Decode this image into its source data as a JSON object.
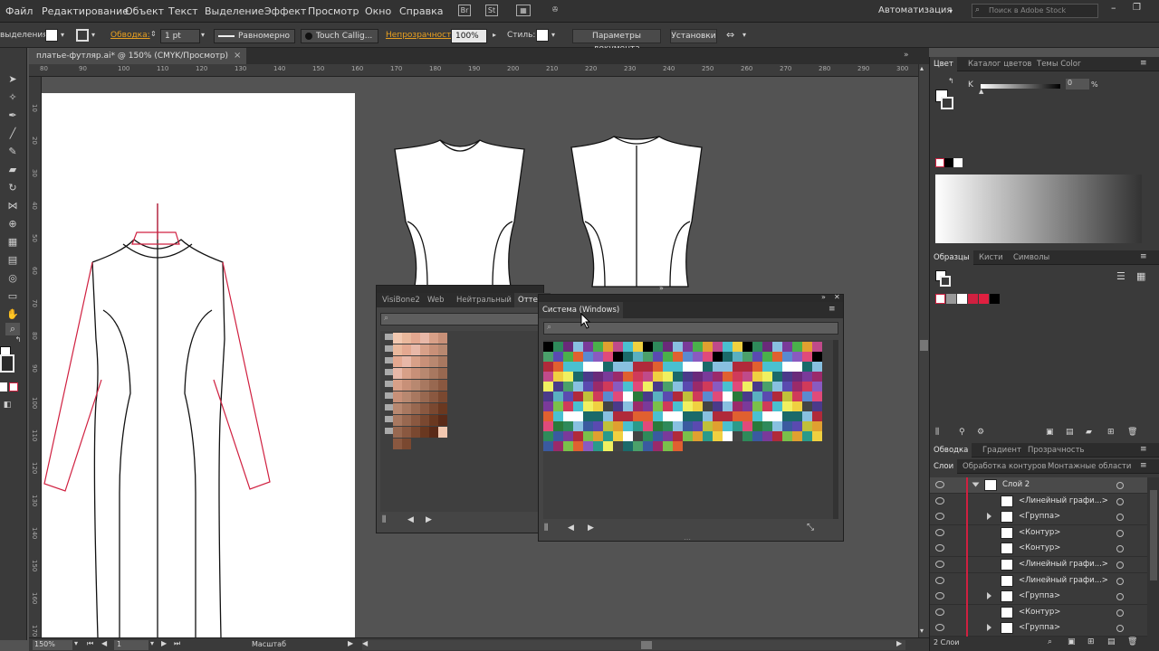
{
  "menubar": {
    "items": [
      "Файл",
      "Редактирование",
      "Объект",
      "Текст",
      "Выделение",
      "Эффект",
      "Просмотр",
      "Окно",
      "Справка"
    ],
    "bridge_icon": "Br",
    "stock_icon": "St",
    "workspace": "Автоматизация",
    "search_placeholder": "Поиск в Adobe Stock"
  },
  "control": {
    "selection_label": "выделения",
    "stroke_label": "Обводка:",
    "stroke_weight": "1 pt",
    "profile": "Равномерно",
    "brush": "Touch Callig...",
    "opacity_label": "Непрозрачность:",
    "opacity_value": "100%",
    "style_label": "Стиль:",
    "doc_settings": "Параметры документа",
    "preferences": "Установки"
  },
  "document": {
    "tab_title": "платье-футляр.ai* @ 150% (CMYK/Просмотр)",
    "close": "×"
  },
  "ruler": {
    "h_labels": [
      "80",
      "90",
      "100",
      "110",
      "120",
      "130",
      "140",
      "150",
      "160",
      "170",
      "180",
      "190",
      "200",
      "210",
      "220",
      "230",
      "240",
      "250",
      "260",
      "270",
      "280",
      "290",
      "300"
    ],
    "v_labels": [
      "10",
      "20",
      "30",
      "40",
      "50",
      "60",
      "70",
      "80",
      "90",
      "100",
      "110",
      "120",
      "130",
      "140",
      "150",
      "160",
      "170"
    ]
  },
  "status": {
    "zoom": "150%",
    "artboard": "1",
    "mode": "Масштаб"
  },
  "panels": {
    "color_tabs": [
      "Цвет",
      "Каталог цветов",
      "Темы Color"
    ],
    "color_k_label": "K",
    "color_k_value": "0",
    "color_k_unit": "%",
    "swatch_tabs": [
      "Образцы",
      "Кисти",
      "Символы"
    ],
    "stroke_tabs": [
      "Обводка",
      "Градиент",
      "Прозрачность"
    ],
    "layer_tabs": [
      "Слои",
      "Обработка контуров",
      "Монтажные области"
    ],
    "layers": [
      {
        "name": "Слой 2",
        "expanded": true
      },
      {
        "name": "<Линейный графи...>",
        "expanded": false
      },
      {
        "name": "<Группа>",
        "expanded": false
      },
      {
        "name": "<Контур>",
        "expanded": false
      },
      {
        "name": "<Контур>",
        "expanded": false
      },
      {
        "name": "<Линейный графи...>",
        "expanded": false
      },
      {
        "name": "<Линейный графи...>",
        "expanded": false
      },
      {
        "name": "<Группа>",
        "expanded": false
      },
      {
        "name": "<Контур>",
        "expanded": false
      },
      {
        "name": "<Группа>",
        "expanded": false
      }
    ],
    "layers_count": "2 Слои"
  },
  "library_back": {
    "tabs": [
      "VisiBone2",
      "Web",
      "Нейтральный",
      "Оттеко"
    ]
  },
  "library_front": {
    "title": "Система (Windows)"
  },
  "colors": {
    "accent_red": "#d02040",
    "panel_bg": "#3a3a3a"
  }
}
